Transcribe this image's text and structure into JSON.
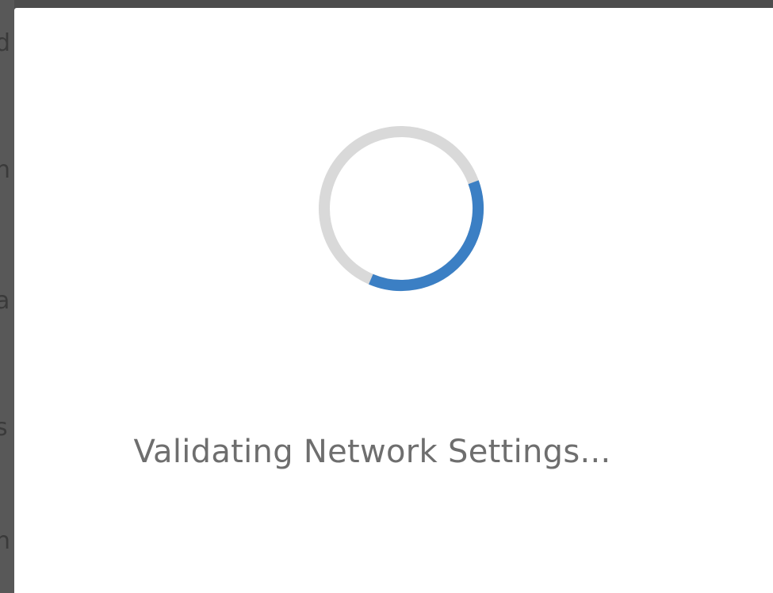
{
  "dialog": {
    "message": "Validating Network Settings..."
  },
  "spinner": {
    "progress": 0.37,
    "track_color": "#d9d9d9",
    "arc_color": "#3b7fc4"
  },
  "colors": {
    "backdrop": "#4d4d4d",
    "dialog_background": "#ffffff",
    "message_text": "#6e6e6e"
  }
}
